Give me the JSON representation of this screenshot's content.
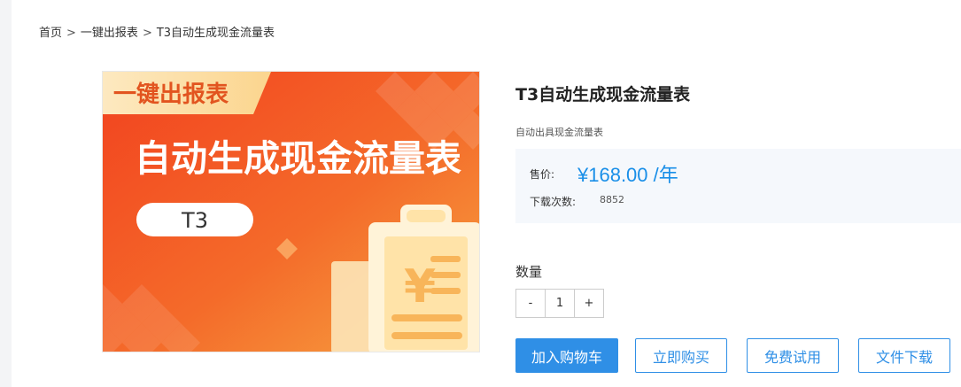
{
  "breadcrumb": {
    "items": [
      "首页",
      "一键出报表",
      "T3自动生成现金流量表"
    ],
    "separator": ">"
  },
  "product_image": {
    "banner_tag": "一键出报表",
    "headline": "自动生成现金流量表",
    "pill_text": "T3",
    "currency_symbol": "¥"
  },
  "product": {
    "title": "T3自动生成现金流量表",
    "subtitle": "自动出具现金流量表",
    "price_label": "售价:",
    "price_value": "¥168.00 /年",
    "downloads_label": "下载次数:",
    "downloads_value": "8852"
  },
  "quantity": {
    "label": "数量",
    "minus": "-",
    "value": "1",
    "plus": "+"
  },
  "actions": {
    "add_to_cart": "加入购物车",
    "buy_now": "立即购买",
    "free_trial": "免费试用",
    "download": "文件下载"
  },
  "colors": {
    "accent": "#2f8fe6",
    "price": "#1a8fe8",
    "banner_orange": "#f26a2a"
  }
}
